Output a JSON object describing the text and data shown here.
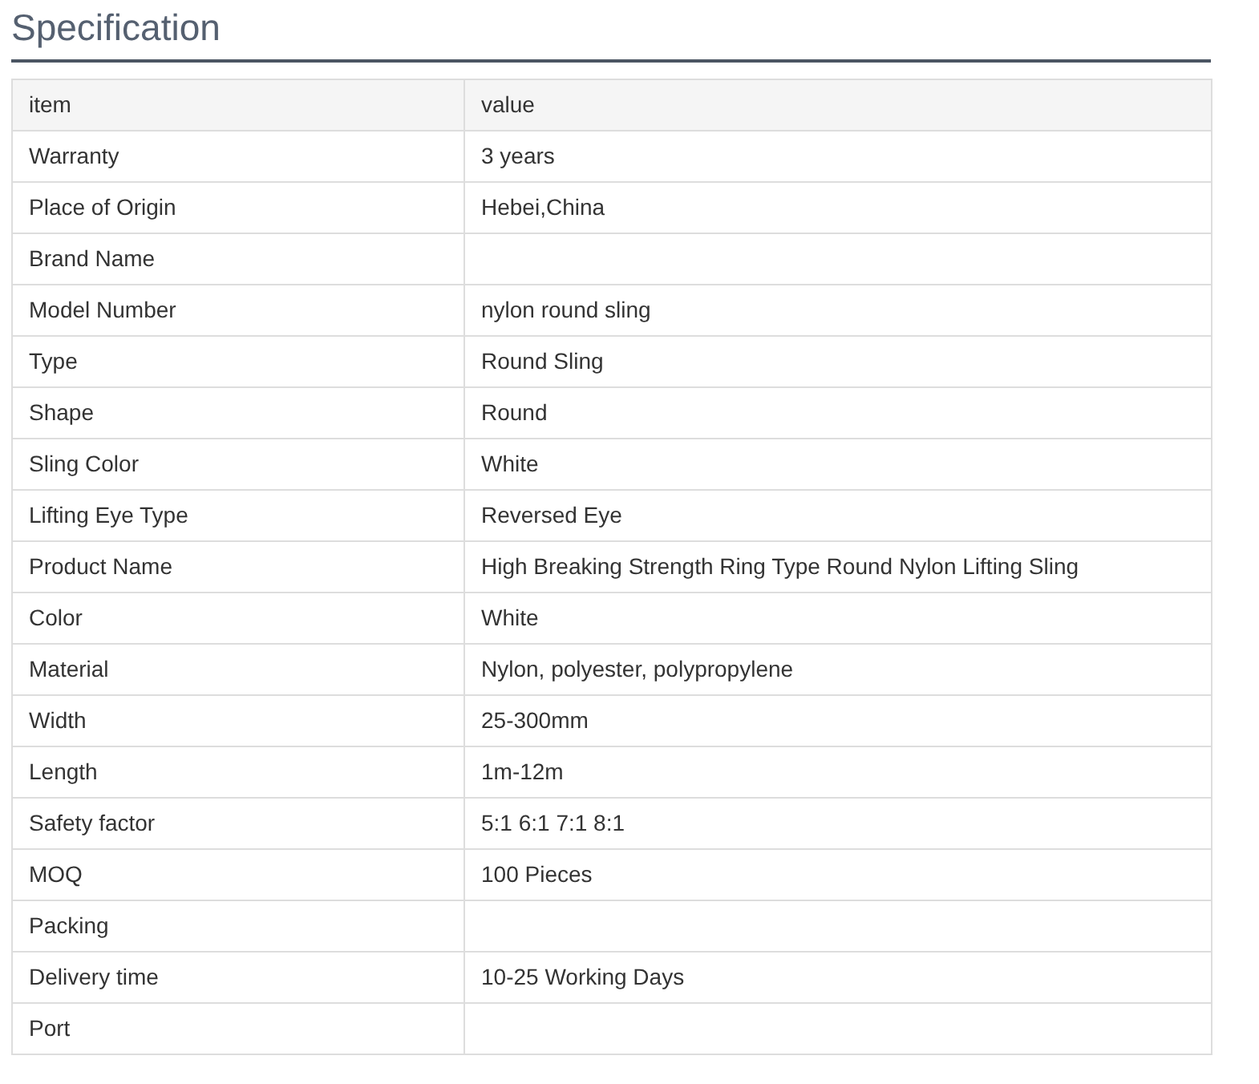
{
  "title": "Specification",
  "table": {
    "columns": [
      "item",
      "value"
    ],
    "rows": [
      {
        "item": "Warranty",
        "value": "3 years"
      },
      {
        "item": "Place of Origin",
        "value": "Hebei,China"
      },
      {
        "item": "Brand Name"
      },
      {
        "item": "Model Number",
        "value": "nylon round sling"
      },
      {
        "item": "Type",
        "value": "Round Sling"
      },
      {
        "item": "Shape",
        "value": "Round"
      },
      {
        "item": "Sling Color",
        "value": "White"
      },
      {
        "item": "Lifting Eye Type",
        "value": "Reversed Eye"
      },
      {
        "item": "Product Name",
        "value": "High Breaking Strength Ring Type Round Nylon Lifting Sling"
      },
      {
        "item": "Color",
        "value": "White"
      },
      {
        "item": "Material",
        "value": "Nylon, polyester, polypropylene"
      },
      {
        "item": "Width",
        "value": "25-300mm"
      },
      {
        "item": "Length",
        "value": "1m-12m"
      },
      {
        "item": "Safety factor",
        "value": "5:1 6:1 7:1 8:1"
      },
      {
        "item": "MOQ",
        "value": "100 Pieces"
      },
      {
        "item": "Packing"
      },
      {
        "item": "Delivery time",
        "value": "10-25 Working Days"
      },
      {
        "item": "Port"
      }
    ]
  }
}
